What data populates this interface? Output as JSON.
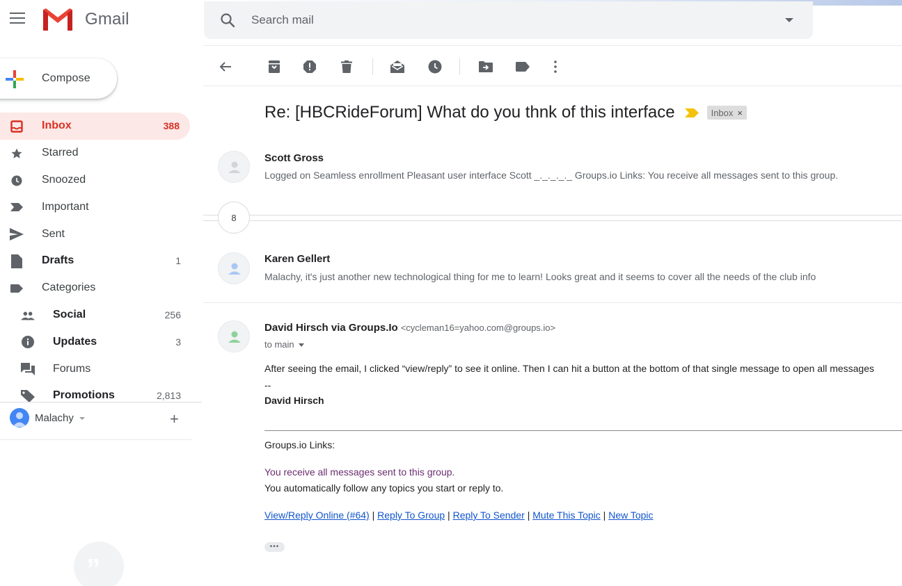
{
  "app": {
    "name": "Gmail"
  },
  "search": {
    "placeholder": "Search mail"
  },
  "compose": {
    "label": "Compose"
  },
  "sidebar": {
    "items": [
      {
        "label": "Inbox",
        "count": "388"
      },
      {
        "label": "Starred",
        "count": ""
      },
      {
        "label": "Snoozed",
        "count": ""
      },
      {
        "label": "Important",
        "count": ""
      },
      {
        "label": "Sent",
        "count": ""
      },
      {
        "label": "Drafts",
        "count": "1"
      },
      {
        "label": "Categories",
        "count": ""
      },
      {
        "label": "Social",
        "count": "256"
      },
      {
        "label": "Updates",
        "count": "3"
      },
      {
        "label": "Forums",
        "count": ""
      },
      {
        "label": "Promotions",
        "count": "2,813"
      }
    ]
  },
  "account": {
    "name": "Malachy"
  },
  "thread": {
    "subject": "Re: [HBCRideForum] What do you thnk of this interface",
    "label": "Inbox",
    "label_close": "×",
    "collapsed_count": "8",
    "messages": [
      {
        "sender": "Scott Gross",
        "snippet": "Logged on Seamless enrollment Pleasant user interface Scott _._._._._ Groups.io Links: You receive all messages sent to this group."
      },
      {
        "sender": "Karen Gellert",
        "snippet": "Malachy, it's just another new technological thing for me to learn! Looks great and it seems to cover all the needs of the club info"
      }
    ],
    "open_message": {
      "sender": "David Hirsch via Groups.Io",
      "email": "<cycleman16=yahoo.com@groups.io>",
      "to": "to main",
      "body": "After seeing the email, I clicked “view/reply” to see it online. Then I can hit a button at the bottom of that single message to open all messages",
      "sig_dash": "--",
      "sig_name": "David Hirsch",
      "links_heading": "Groups.io Links:",
      "notice_1": "You receive all messages sent to this group.",
      "notice_2": "You automatically follow any topics you start or reply to.",
      "links": [
        "View/Reply Online (#64)",
        "Reply To Group",
        "Reply To Sender",
        "Mute This Topic",
        "New Topic"
      ],
      "link_separator": "|",
      "trimmed": "•••"
    }
  },
  "colors": {
    "gmail_red": "#d93025",
    "inbox_active_bg": "#fce8e6",
    "importance_yellow": "#f4c20d",
    "link_blue": "#1155cc",
    "notice_purple": "#6a2c70"
  }
}
